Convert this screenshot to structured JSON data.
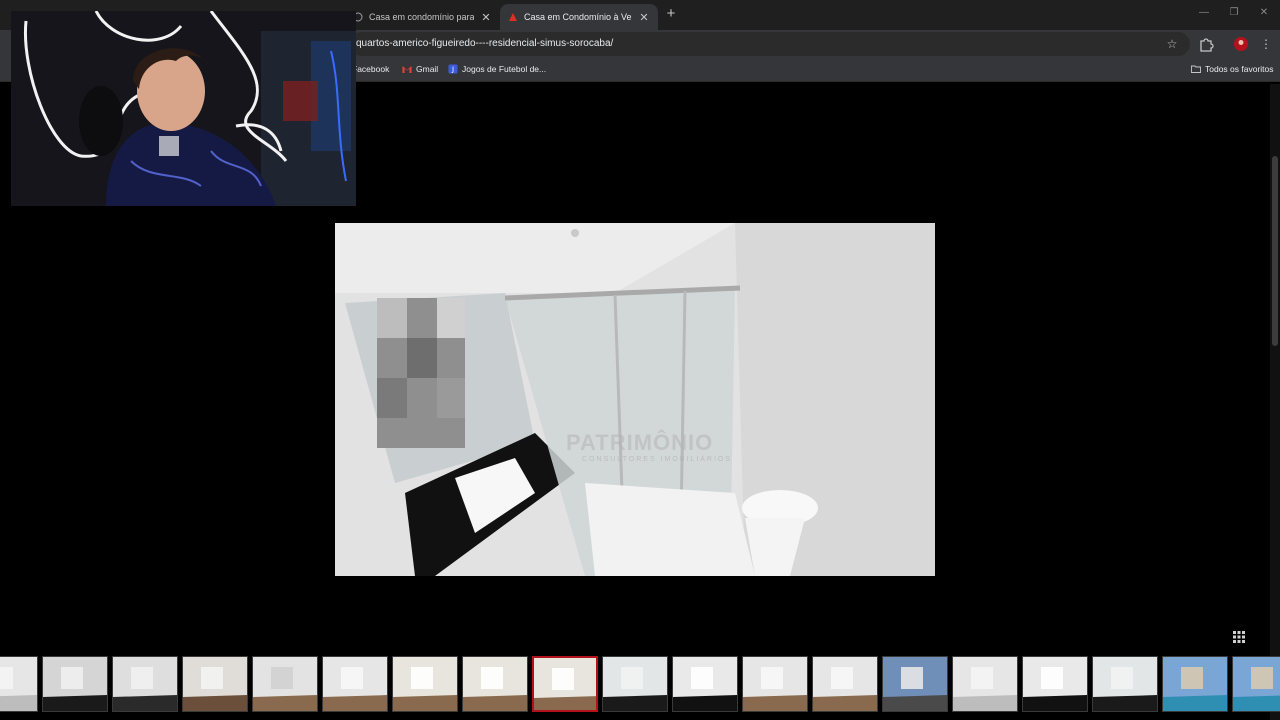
{
  "browser": {
    "tabs": [
      {
        "title": "Casa em condomínio para alug",
        "active": false
      },
      {
        "title": "Casa em Condomínio à Venda",
        "active": true
      }
    ],
    "url": "quartos-americo-figueiredo----residencial-simus-sorocaba/",
    "bookmarks": [
      {
        "label": "Facebook",
        "icon": "facebook-icon"
      },
      {
        "label": "Gmail",
        "icon": "gmail-icon"
      },
      {
        "label": "Jogos de Futebol de...",
        "icon": "bookmark-favicon"
      }
    ],
    "all_bookmarks_label": "Todos os favoritos"
  },
  "photo": {
    "watermark": "PATRIMÔNIO",
    "watermark_sub": "CONSULTORES IMOBILIÁRIOS"
  },
  "gallery": {
    "active_index": 8,
    "thumbnails": [
      {
        "scene": "bathroom"
      },
      {
        "scene": "kitchen-dark"
      },
      {
        "scene": "kitchen"
      },
      {
        "scene": "stairs"
      },
      {
        "scene": "hallway"
      },
      {
        "scene": "room-window"
      },
      {
        "scene": "room-closet"
      },
      {
        "scene": "room-closet"
      },
      {
        "scene": "room-closet"
      },
      {
        "scene": "bathroom-shower"
      },
      {
        "scene": "bathroom-sink"
      },
      {
        "scene": "room-window"
      },
      {
        "scene": "room-window"
      },
      {
        "scene": "balcony"
      },
      {
        "scene": "bathroom"
      },
      {
        "scene": "bathroom-sink"
      },
      {
        "scene": "bathroom-shower"
      },
      {
        "scene": "pool"
      },
      {
        "scene": "pool"
      }
    ]
  },
  "colors": {
    "accent": "#b3121d",
    "background": "#000000",
    "chrome": "#35363a"
  }
}
